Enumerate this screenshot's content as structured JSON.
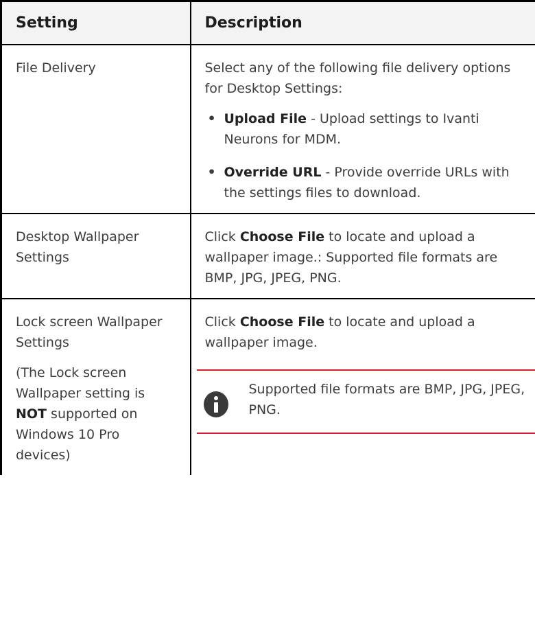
{
  "table": {
    "headers": [
      "Setting",
      "Description"
    ],
    "rows": [
      {
        "setting": "File Delivery",
        "intro": "Select any of the following file delivery options for Desktop Settings:",
        "options": [
          {
            "label": "Upload File",
            "text": " - Upload settings to Ivanti Neurons for MDM."
          },
          {
            "label": "Override URL",
            "text": " - Provide override URLs with the settings files to download."
          }
        ]
      },
      {
        "setting": "Desktop Wallpaper Settings",
        "desc_pre": "Click ",
        "desc_bold": "Choose File",
        "desc_post": " to locate and upload a wallpaper image.: Supported file formats are BMP, JPG, JPEG, PNG."
      },
      {
        "setting": "Lock screen Wallpaper Settings",
        "note_pre": "(The Lock screen Wallpaper setting is ",
        "note_bold": "NOT",
        "note_post": " supported on Windows 10 Pro devices)",
        "desc_pre": "Click ",
        "desc_bold": "Choose File",
        "desc_post": " to locate and upload a wallpaper image.",
        "callout": "Supported file formats are BMP, JPG, JPEG, PNG.",
        "callout_icon": "info-icon",
        "callout_rule_color": "#d0202a"
      }
    ]
  }
}
